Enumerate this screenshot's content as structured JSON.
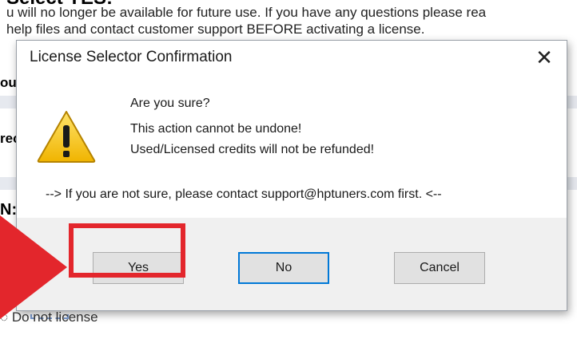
{
  "background": {
    "heading": "Select YES:",
    "line1": "u will no longer be available for future use. If you have any questions please rea",
    "line2": "help files and contact customer support BEFORE activating a license.",
    "left_fragment_1": "our",
    "left_fragment_2": "rec",
    "left_fragment_3": "N:",
    "bottom_option": "Do not license"
  },
  "dialog": {
    "title": "License Selector Confirmation",
    "close_glyph": "✕",
    "question": "Are you sure?",
    "message_1": "This action cannot be undone!",
    "message_2": "Used/Licensed credits will not be refunded!",
    "contact": "--> If you are not sure, please contact support@hptuners.com first. <--",
    "buttons": {
      "yes": "Yes",
      "no": "No",
      "cancel": "Cancel"
    }
  },
  "colors": {
    "highlight": "#e3262c",
    "arrow": "#e3262c",
    "focus_border": "#0078d7"
  },
  "icons": {
    "warning": "warning-triangle-icon",
    "close": "close-icon",
    "arrow": "pointer-arrow-icon"
  }
}
